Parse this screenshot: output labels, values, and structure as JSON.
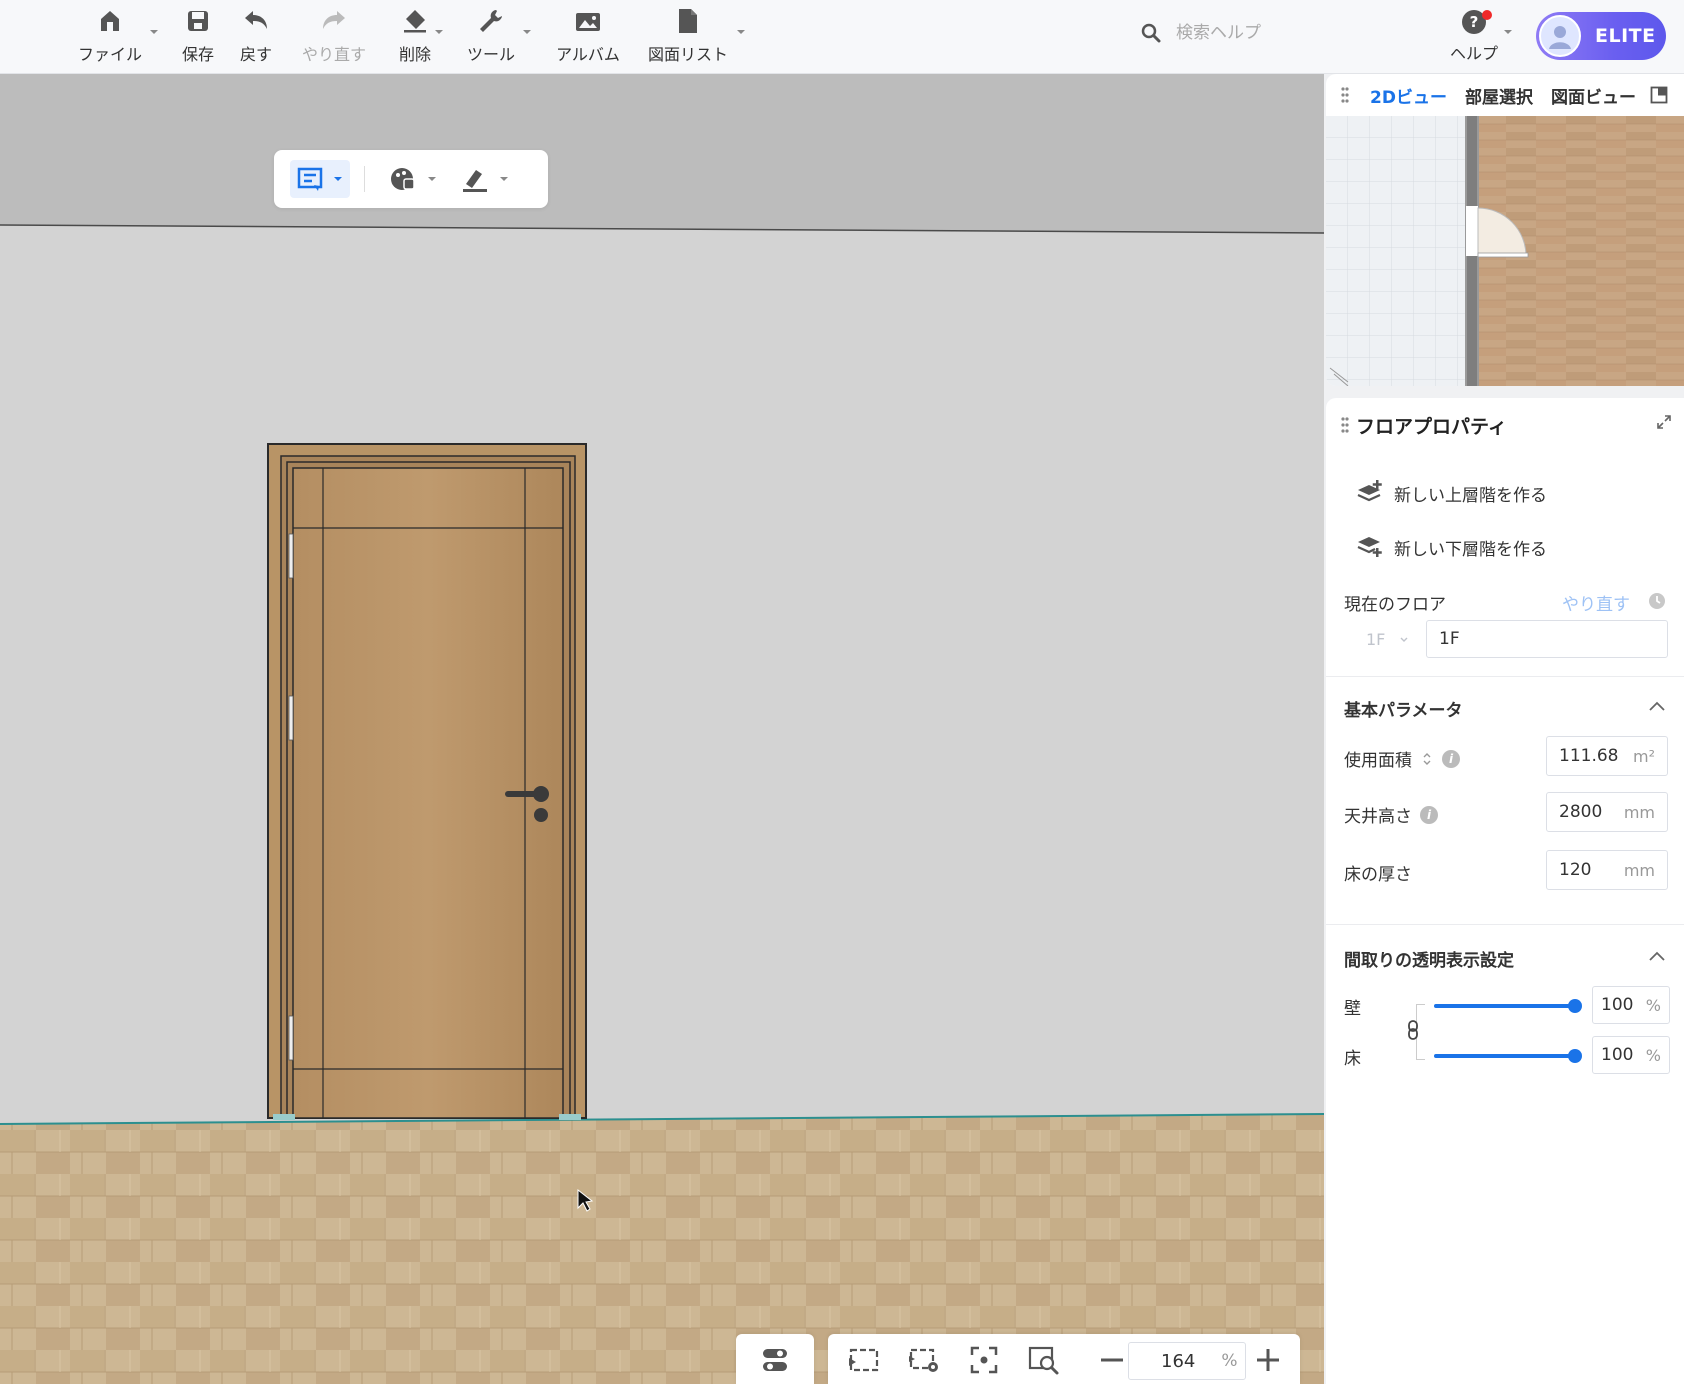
{
  "toolbar": {
    "file": "ファイル",
    "save": "保存",
    "undo": "戻す",
    "redo": "やり直す",
    "delete": "削除",
    "tools": "ツール",
    "album": "アルバム",
    "drawing_list": "図面リスト",
    "search_placeholder": "検索ヘルプ",
    "help": "ヘルプ",
    "elite": "ELITE"
  },
  "mini_view": {
    "tabs": [
      {
        "label": "2Dビュー",
        "active": true
      },
      {
        "label": "部屋選択",
        "active": false
      },
      {
        "label": "図面ビュー",
        "active": false
      }
    ]
  },
  "floor_properties": {
    "title": "フロアプロパティ",
    "create_upper": "新しい上層階を作る",
    "create_lower": "新しい下層階を作る",
    "current_floor_label": "現在のフロア",
    "redo_link": "やり直す",
    "floor_select_value": "1F",
    "floor_name_value": "1F"
  },
  "basic_params": {
    "title": "基本パラメータ",
    "usable_area_label": "使用面積",
    "usable_area_value": "111.68",
    "usable_area_unit": "m²",
    "ceiling_height_label": "天井高さ",
    "ceiling_height_value": "2800",
    "ceiling_height_unit": "mm",
    "floor_thickness_label": "床の厚さ",
    "floor_thickness_value": "120",
    "floor_thickness_unit": "mm"
  },
  "transparency": {
    "title": "間取りの透明表示設定",
    "wall_label": "壁",
    "wall_value": "100",
    "wall_unit": "%",
    "wall_level": 1.0,
    "floor_label": "床",
    "floor_value": "100",
    "floor_unit": "%",
    "floor_level": 1.0
  },
  "zoom": {
    "value": "164",
    "unit": "%"
  },
  "colors": {
    "accent": "#1a73e8",
    "elite_start": "#8f7bf5",
    "elite_end": "#5d58ec",
    "wall": "#d3d3d3",
    "ceiling": "#bcbcbc",
    "door_wood": "#b08a5f",
    "floor_wood": "#cbb390"
  },
  "icons": [
    "home-icon",
    "save-icon",
    "undo-icon",
    "redo-icon",
    "eraser-icon",
    "wrench-icon",
    "album-icon",
    "document-icon",
    "search-icon",
    "help-icon",
    "user-avatar-icon",
    "comment-select-icon",
    "palette-icon",
    "brush-icon",
    "toggle-icon",
    "view-frame-icon",
    "view-settings-icon",
    "focus-icon",
    "zoom-fit-icon",
    "minus-icon",
    "plus-icon",
    "layers-add-up-icon",
    "layers-add-down-icon",
    "expand-icon",
    "clock-icon",
    "info-icon",
    "link-icon",
    "chevron-up-icon",
    "drag-grip-icon",
    "dock-icon"
  ]
}
